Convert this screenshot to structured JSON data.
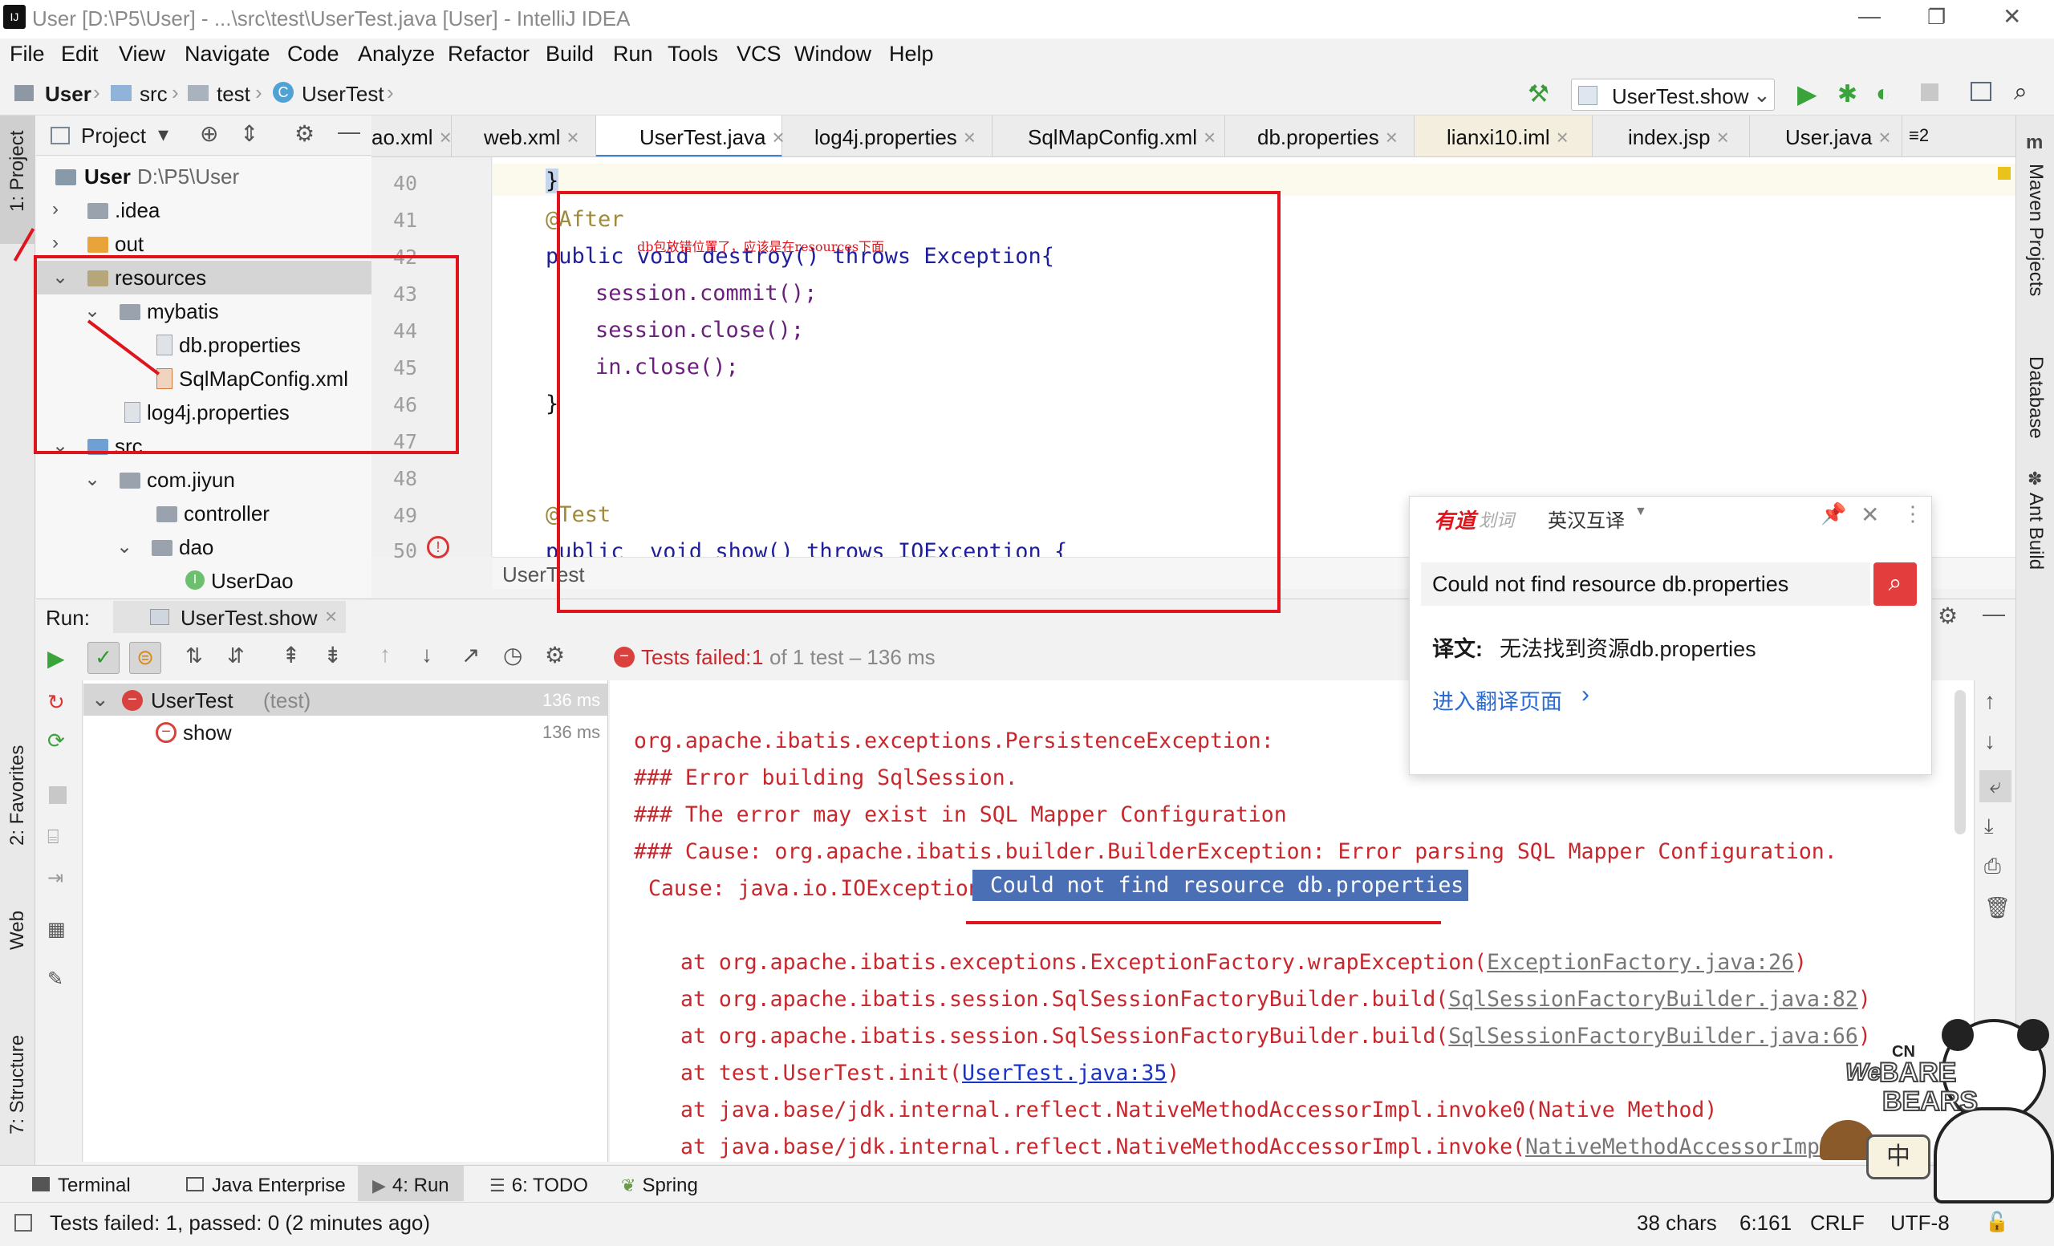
{
  "window": {
    "title": "User [D:\\P5\\User] - ...\\src\\test\\UserTest.java [User] - IntelliJ IDEA",
    "minimize": "—",
    "restore": "❐",
    "close": "✕"
  },
  "menu": [
    "File",
    "Edit",
    "View",
    "Navigate",
    "Code",
    "Analyze",
    "Refactor",
    "Build",
    "Run",
    "Tools",
    "VCS",
    "Window",
    "Help"
  ],
  "breadcrumb": {
    "project": "User",
    "src": "src",
    "test": "test",
    "file": "UserTest"
  },
  "run_config": "UserTest.show",
  "project_panel": {
    "title": "Project",
    "root": "User",
    "root_path": "D:\\P5\\User",
    "items": [
      ".idea",
      "out",
      "resources",
      "mybatis",
      "db.properties",
      "SqlMapConfig.xml",
      "log4j.properties",
      "src",
      "com.jiyun",
      "controller",
      "dao",
      "UserDao"
    ]
  },
  "tabs": [
    "ao.xml",
    "web.xml",
    "UserTest.java",
    "log4j.properties",
    "SqlMapConfig.xml",
    "db.properties",
    "lianxi10.iml",
    "index.jsp",
    "User.java"
  ],
  "tab_overflow": "≡2",
  "editor": {
    "line_numbers": [
      "40",
      "41",
      "42",
      "43",
      "44",
      "45",
      "46",
      "47",
      "48",
      "49",
      "50"
    ],
    "lines": [
      "}",
      "@After",
      "public void destroy() throws Exception{",
      "session.commit();",
      "session.close();",
      "in.close();",
      "}",
      "",
      "",
      "@Test",
      "public  void show() throws IOException {"
    ],
    "annotation_note": "db包放错位置了，应该是在resources下面",
    "footer": "UserTest"
  },
  "run": {
    "label": "Run:",
    "tab": "UserTest.show",
    "status_prefix": "Tests failed:",
    "status_count": "1",
    "status_suffix": "of 1 test – 136 ms",
    "tree": [
      {
        "name": "UserTest",
        "suffix": "(test)",
        "time": "136 ms"
      },
      {
        "name": "show",
        "time": "136 ms"
      }
    ]
  },
  "console": {
    "lines": [
      "org.apache.ibatis.exceptions.PersistenceException:",
      "### Error building SqlSession.",
      "### The error may exist in SQL Mapper Configuration",
      "### Cause: org.apache.ibatis.builder.BuilderException: Error parsing SQL Mapper Configuration."
    ],
    "cause_prefix": "Cause: java.io.IOException:",
    "cause_highlight": " Could not find resource db.properties",
    "stack": [
      {
        "text": "at org.apache.ibatis.exceptions.ExceptionFactory.wrapException(",
        "link": "ExceptionFactory.java:26",
        "end": ")"
      },
      {
        "text": "at org.apache.ibatis.session.SqlSessionFactoryBuilder.build(",
        "link": "SqlSessionFactoryBuilder.java:82",
        "end": ")"
      },
      {
        "text": "at org.apache.ibatis.session.SqlSessionFactoryBuilder.build(",
        "link": "SqlSessionFactoryBuilder.java:66",
        "end": ")"
      },
      {
        "text": "at test.UserTest.init(",
        "link": "UserTest.java:35",
        "end": ")"
      },
      {
        "text": "at java.base/jdk.internal.reflect.NativeMethodAccessorImpl.invoke0(Native Method)",
        "link": "",
        "end": ""
      },
      {
        "text": "at java.base/jdk.internal.reflect.NativeMethodAccessorImpl.invoke(",
        "link": "NativeMethodAccessorImpl",
        "end": ""
      }
    ]
  },
  "translator": {
    "brand": "有道",
    "mode": "划词",
    "lang": "英汉互译",
    "query": "Could not find resource db.properties",
    "result_label": "译文:",
    "result": "无法找到资源db.properties",
    "link": "进入翻译页面"
  },
  "bottom_tabs": [
    "Terminal",
    "Java Enterprise",
    "4: Run",
    "6: TODO",
    "Spring"
  ],
  "status": {
    "message": "Tests failed: 1, passed: 0 (2 minutes ago)",
    "chars": "38 chars",
    "position": "6:161",
    "line_sep": "CRLF",
    "encoding": "UTF-8"
  },
  "side": {
    "left": [
      "1: Project",
      "2: Favorites",
      "Web",
      "7: Structure"
    ],
    "right": [
      "Maven Projects",
      "Database",
      "Ant Build"
    ]
  },
  "sticker": {
    "line1": "We",
    "line2": "BARE",
    "line3": "BEARS",
    "badge": "中",
    "cn": "CN"
  },
  "colors": {
    "error": "#c7282e",
    "highlight": "#4a6fb5",
    "annotation_red": "#e0141d"
  }
}
